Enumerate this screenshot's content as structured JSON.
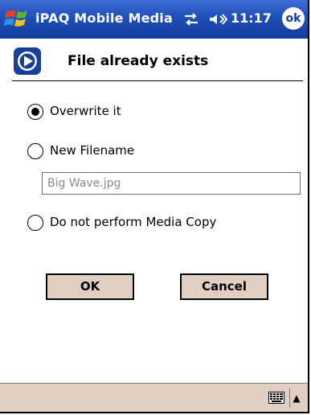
{
  "titlebar": {
    "app_title": "iPAQ Mobile Media",
    "clock": "11:17",
    "ok_label": "ok",
    "start_icon": "windows-flag-icon",
    "connectivity_icon": "connectivity-arrows-icon",
    "volume_icon": "speaker-volume-icon"
  },
  "dialog": {
    "title": "File already exists",
    "header_icon": "media-play-icon",
    "options": [
      {
        "label": "Overwrite it",
        "selected": true
      },
      {
        "label": "New Filename",
        "selected": false
      },
      {
        "label": "Do not perform Media Copy",
        "selected": false
      }
    ],
    "filename_value": "Big Wave.jpg",
    "ok_label": "OK",
    "cancel_label": "Cancel"
  },
  "bottombar": {
    "keyboard_icon": "keyboard-icon",
    "sip_arrow": "▲"
  },
  "colors": {
    "titlebar": "#1f4fb8",
    "button_face": "#e2cfc3",
    "header_icon": "#1a3f9a"
  }
}
